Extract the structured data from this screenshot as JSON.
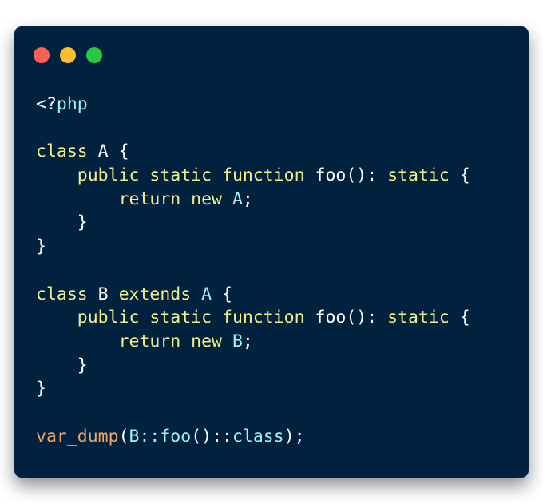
{
  "window": {
    "controls": [
      {
        "name": "close",
        "color": "#fe5f57"
      },
      {
        "name": "minimize",
        "color": "#febc2e"
      },
      {
        "name": "maximize",
        "color": "#28c840"
      }
    ]
  },
  "colors": {
    "background": "#00223f",
    "plain": "#ffffff",
    "keyword": "#f1f08a",
    "type": "#9ff2f6",
    "function": "#f2a262"
  },
  "code": {
    "language": "php",
    "lines": [
      [
        {
          "t": "<?",
          "c": "plain"
        },
        {
          "t": "php",
          "c": "type"
        }
      ],
      [],
      [
        {
          "t": "class",
          "c": "keyword"
        },
        {
          "t": " A {",
          "c": "plain"
        }
      ],
      [
        {
          "t": "    ",
          "c": "plain"
        },
        {
          "t": "public static function",
          "c": "keyword"
        },
        {
          "t": " foo(): ",
          "c": "plain"
        },
        {
          "t": "static",
          "c": "keyword"
        },
        {
          "t": " {",
          "c": "plain"
        }
      ],
      [
        {
          "t": "        ",
          "c": "plain"
        },
        {
          "t": "return new",
          "c": "keyword"
        },
        {
          "t": " ",
          "c": "plain"
        },
        {
          "t": "A",
          "c": "type"
        },
        {
          "t": ";",
          "c": "plain"
        }
      ],
      [
        {
          "t": "    }",
          "c": "plain"
        }
      ],
      [
        {
          "t": "}",
          "c": "plain"
        }
      ],
      [],
      [
        {
          "t": "class",
          "c": "keyword"
        },
        {
          "t": " B ",
          "c": "plain"
        },
        {
          "t": "extends",
          "c": "keyword"
        },
        {
          "t": " ",
          "c": "plain"
        },
        {
          "t": "A",
          "c": "type"
        },
        {
          "t": " {",
          "c": "plain"
        }
      ],
      [
        {
          "t": "    ",
          "c": "plain"
        },
        {
          "t": "public static function",
          "c": "keyword"
        },
        {
          "t": " foo(): ",
          "c": "plain"
        },
        {
          "t": "static",
          "c": "keyword"
        },
        {
          "t": " {",
          "c": "plain"
        }
      ],
      [
        {
          "t": "        ",
          "c": "plain"
        },
        {
          "t": "return new",
          "c": "keyword"
        },
        {
          "t": " ",
          "c": "plain"
        },
        {
          "t": "B",
          "c": "type"
        },
        {
          "t": ";",
          "c": "plain"
        }
      ],
      [
        {
          "t": "    }",
          "c": "plain"
        }
      ],
      [
        {
          "t": "}",
          "c": "plain"
        }
      ],
      [],
      [
        {
          "t": "var_dump",
          "c": "func"
        },
        {
          "t": "(",
          "c": "plain"
        },
        {
          "t": "B::foo",
          "c": "type"
        },
        {
          "t": "()::",
          "c": "plain"
        },
        {
          "t": "class",
          "c": "type"
        },
        {
          "t": ");",
          "c": "plain"
        }
      ]
    ]
  }
}
